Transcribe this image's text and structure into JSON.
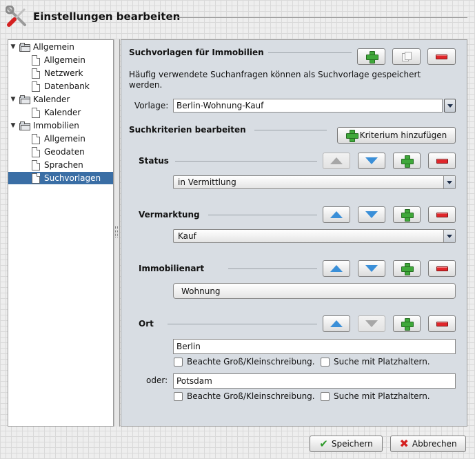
{
  "window": {
    "title": "Einstellungen bearbeiten"
  },
  "tree": [
    {
      "label": "Allgemein",
      "type": "folder",
      "expanded": true
    },
    {
      "label": "Allgemein",
      "type": "doc"
    },
    {
      "label": "Netzwerk",
      "type": "doc"
    },
    {
      "label": "Datenbank",
      "type": "doc"
    },
    {
      "label": "Kalender",
      "type": "folder",
      "expanded": true
    },
    {
      "label": "Kalender",
      "type": "doc"
    },
    {
      "label": "Immobilien",
      "type": "folder",
      "expanded": true
    },
    {
      "label": "Allgemein",
      "type": "doc"
    },
    {
      "label": "Geodaten",
      "type": "doc"
    },
    {
      "label": "Sprachen",
      "type": "doc"
    },
    {
      "label": "Suchvorlagen",
      "type": "doc",
      "selected": true
    }
  ],
  "templates": {
    "title": "Suchvorlagen für Immobilien",
    "description": "Häufig verwendete Suchanfragen können als Suchvorlage gespeichert werden.",
    "vorlage_label": "Vorlage:",
    "vorlage_value": "Berlin-Wohnung-Kauf"
  },
  "criteria": {
    "title": "Suchkriterien bearbeiten",
    "add_label": "Kriterium hinzufügen",
    "status": {
      "title": "Status",
      "value": "in Vermittlung"
    },
    "vermarktung": {
      "title": "Vermarktung",
      "value": "Kauf"
    },
    "immobilienart": {
      "title": "Immobilienart",
      "value": "Wohnung"
    },
    "ort": {
      "title": "Ort",
      "or_label": "oder:",
      "entries": [
        {
          "value": "Berlin",
          "case_label": "Beachte Groß/Kleinschreibung.",
          "wildcard_label": "Suche mit Platzhaltern."
        },
        {
          "value": "Potsdam",
          "case_label": "Beachte Groß/Kleinschreibung.",
          "wildcard_label": "Suche mit Platzhaltern."
        }
      ]
    }
  },
  "footer": {
    "save_label": "Speichern",
    "cancel_label": "Abbrechen"
  },
  "colors": {
    "selection": "#3a6ea5",
    "panel": "#d8dde3",
    "add": "#3fa83a",
    "remove": "#e0262a",
    "arrow": "#3a8fd8"
  }
}
